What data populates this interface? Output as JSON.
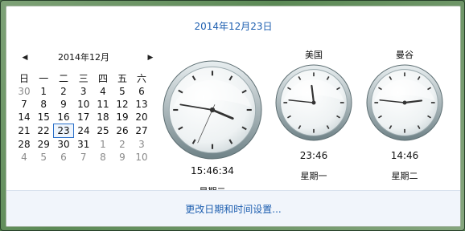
{
  "header": {
    "date": "2014年12月23日"
  },
  "calendar": {
    "title": "2014年12月",
    "prev_icon": "triangle-left",
    "next_icon": "triangle-right",
    "weekdays": [
      "日",
      "一",
      "二",
      "三",
      "四",
      "五",
      "六"
    ],
    "weeks": [
      [
        {
          "d": "30",
          "o": true
        },
        {
          "d": "1"
        },
        {
          "d": "2"
        },
        {
          "d": "3"
        },
        {
          "d": "4"
        },
        {
          "d": "5"
        },
        {
          "d": "6"
        }
      ],
      [
        {
          "d": "7"
        },
        {
          "d": "8"
        },
        {
          "d": "9"
        },
        {
          "d": "10"
        },
        {
          "d": "11"
        },
        {
          "d": "12"
        },
        {
          "d": "13"
        }
      ],
      [
        {
          "d": "14"
        },
        {
          "d": "15"
        },
        {
          "d": "16"
        },
        {
          "d": "17"
        },
        {
          "d": "18"
        },
        {
          "d": "19"
        },
        {
          "d": "20"
        }
      ],
      [
        {
          "d": "21"
        },
        {
          "d": "22"
        },
        {
          "d": "23",
          "t": true
        },
        {
          "d": "24"
        },
        {
          "d": "25"
        },
        {
          "d": "26"
        },
        {
          "d": "27"
        }
      ],
      [
        {
          "d": "28"
        },
        {
          "d": "29"
        },
        {
          "d": "30"
        },
        {
          "d": "31"
        },
        {
          "d": "1",
          "o": true
        },
        {
          "d": "2",
          "o": true
        },
        {
          "d": "3",
          "o": true
        }
      ],
      [
        {
          "d": "4",
          "o": true
        },
        {
          "d": "5",
          "o": true
        },
        {
          "d": "6",
          "o": true
        },
        {
          "d": "7",
          "o": true
        },
        {
          "d": "8",
          "o": true
        },
        {
          "d": "9",
          "o": true
        },
        {
          "d": "10",
          "o": true
        }
      ]
    ]
  },
  "clocks": [
    {
      "name": "",
      "time": "15:46:34",
      "day": "星期二",
      "h": 15,
      "m": 46,
      "s": 34
    },
    {
      "name": "美国",
      "time": "23:46",
      "day": "星期一",
      "h": 23,
      "m": 46
    },
    {
      "name": "曼谷",
      "time": "14:46",
      "day": "星期二",
      "h": 14,
      "m": 46
    }
  ],
  "footer": {
    "link": "更改日期和时间设置..."
  },
  "colors": {
    "link": "#1e5fb0",
    "today_border": "#2a6fc9"
  }
}
